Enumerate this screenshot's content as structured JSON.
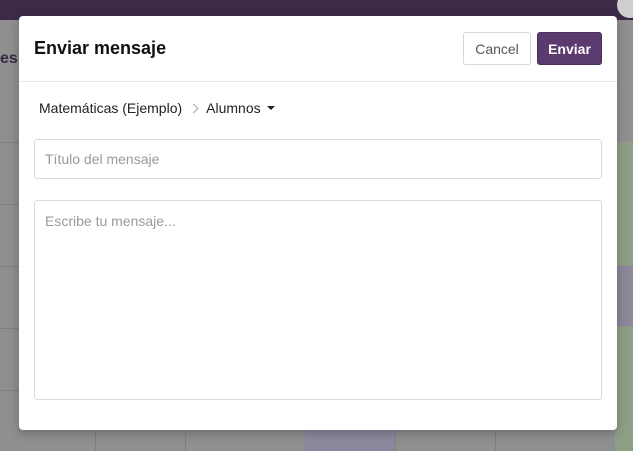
{
  "background": {
    "page_title_fragment": "es"
  },
  "modal": {
    "title": "Enviar mensaje",
    "cancel_label": "Cancel",
    "send_label": "Enviar",
    "breadcrumb": {
      "course": "Matemáticas (Ejemplo)",
      "recipients": "Alumnos"
    },
    "subject_placeholder": "Título del mensaje",
    "body_placeholder": "Escribe tu mensaje..."
  },
  "colors": {
    "primary": "#5b3a6e",
    "topbar": "#3d2a48"
  }
}
